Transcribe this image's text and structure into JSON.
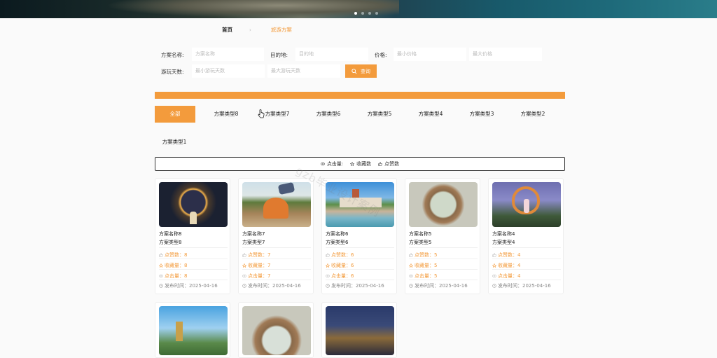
{
  "banner": {
    "slides": 4,
    "active": 0
  },
  "breadcrumb": {
    "home": "首页",
    "separator": "›",
    "current": "旅游方案"
  },
  "filters": {
    "name_label": "方案名称:",
    "name_placeholder": "方案名称",
    "dest_label": "目的地:",
    "dest_placeholder": "目的地",
    "price_label": "价格:",
    "price_min_placeholder": "最小价格",
    "price_max_placeholder": "最大价格",
    "days_label": "游玩天数:",
    "days_min_placeholder": "最小游玩天数",
    "days_max_placeholder": "最大游玩天数",
    "search_label": "查询"
  },
  "tabs": [
    "全部",
    "方案类型8",
    "方案类型7",
    "方案类型6",
    "方案类型5",
    "方案类型4",
    "方案类型3",
    "方案类型2",
    "方案类型1"
  ],
  "sort": {
    "clicks": "点击量:",
    "favorites": "收藏数",
    "likes": "点赞数"
  },
  "cards": [
    {
      "name": "方案名称8",
      "type": "方案类型8",
      "likes": "点赞数：8",
      "favs": "收藏量：8",
      "clicks": "点击量：8",
      "date": "发布时间：2025-04-16"
    },
    {
      "name": "方案名称7",
      "type": "方案类型7",
      "likes": "点赞数：7",
      "favs": "收藏量：7",
      "clicks": "点击量：7",
      "date": "发布时间：2025-04-16"
    },
    {
      "name": "方案名称6",
      "type": "方案类型6",
      "likes": "点赞数：6",
      "favs": "收藏量：6",
      "clicks": "点击量：6",
      "date": "发布时间：2025-04-16"
    },
    {
      "name": "方案名称5",
      "type": "方案类型5",
      "likes": "点赞数：5",
      "favs": "收藏量：5",
      "clicks": "点击量：5",
      "date": "发布时间：2025-04-16"
    },
    {
      "name": "方案名称4",
      "type": "方案类型4",
      "likes": "点赞数：4",
      "favs": "收藏量：4",
      "clicks": "点击量：4",
      "date": "发布时间：2025-04-16"
    }
  ],
  "watermark": "gzb毕业设计案例",
  "colors": {
    "accent": "#f39b3c"
  }
}
